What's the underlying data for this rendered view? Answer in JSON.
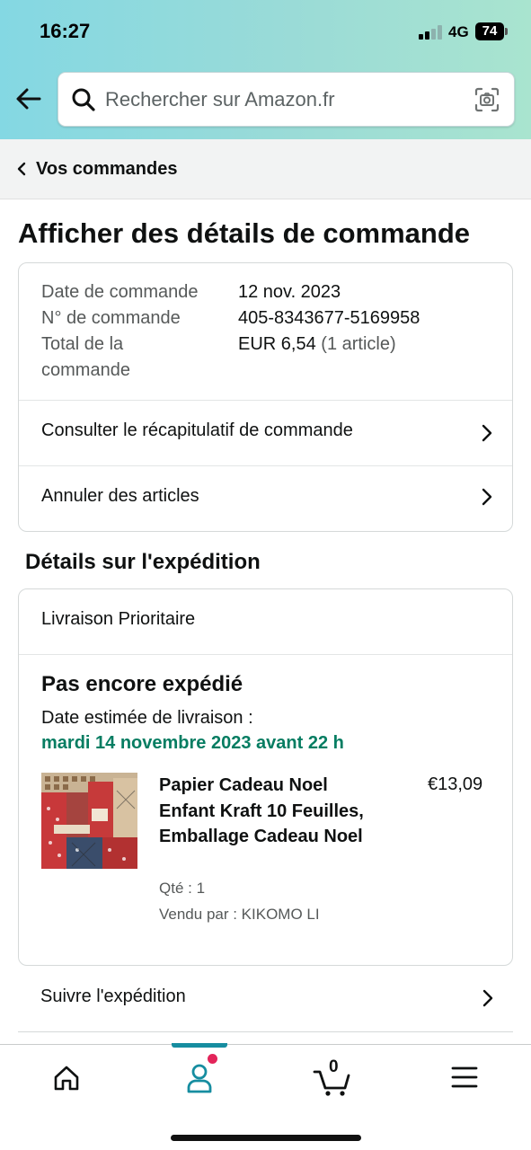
{
  "status_bar": {
    "time": "16:27",
    "network": "4G",
    "battery": "74"
  },
  "search": {
    "placeholder": "Rechercher sur Amazon.fr"
  },
  "breadcrumb": {
    "label": "Vos commandes"
  },
  "page_title": "Afficher des détails de commande",
  "order_summary": {
    "rows": [
      {
        "label": "Date de commande",
        "value": "12 nov. 2023"
      },
      {
        "label": "N° de commande",
        "value": "405-8343677-5169958"
      },
      {
        "label": "Total de la commande",
        "value": "EUR 6,54",
        "value_extra": "(1 article)"
      }
    ],
    "actions": [
      "Consulter le récapitulatif de commande",
      "Annuler des articles"
    ]
  },
  "shipment": {
    "section_title": "Détails sur l'expédition",
    "delivery_type": "Livraison Prioritaire",
    "status": "Pas encore expédié",
    "estimated_label": "Date estimée de livraison :",
    "estimated_date": "mardi 14 novembre 2023 avant 22 h",
    "item": {
      "title": "Papier Cadeau Noel Enfant Kraft 10 Feuilles, Emballage Cadeau Noel",
      "price": "€13,09",
      "quantity": "Qté : 1",
      "seller": "Vendu par : KIKOMO LI"
    },
    "track_label": "Suivre l'expédition"
  },
  "bottom_nav": {
    "items": [
      "home-icon",
      "account-icon",
      "cart-icon",
      "menu-icon"
    ],
    "active": "account-icon",
    "cart_count": "0",
    "colors": {
      "active": "#168da0",
      "notification": "#e3245a",
      "delivery_date": "#067d62"
    }
  }
}
